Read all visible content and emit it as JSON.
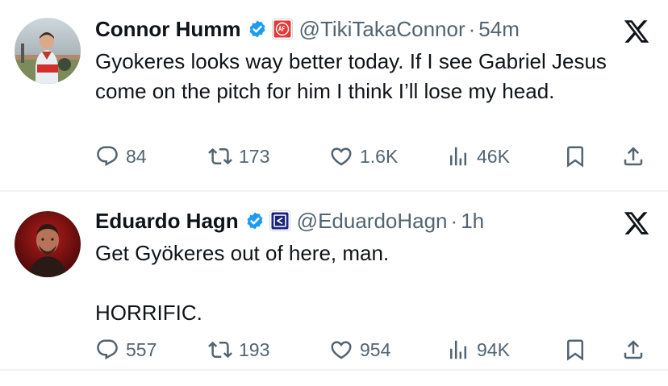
{
  "colors": {
    "text_primary": "#0f1419",
    "text_secondary": "#536471",
    "verified_blue": "#1d9bf0",
    "divider": "#eff3f4"
  },
  "tweets": [
    {
      "name": "Connor Humm",
      "handle": "@TikiTakaConnor",
      "separator": "·",
      "time": "54m",
      "verified_icon": "verified-badge-icon",
      "affiliate_icon": "aftv-badge-icon",
      "text_lines": [
        "Gyokeres looks way better today. If I see Gabriel Jesus come on the pitch for him I think I’ll lose my head."
      ],
      "replies": "84",
      "retweets": "173",
      "likes": "1.6K",
      "views": "46K"
    },
    {
      "name": "Eduardo Hagn",
      "handle": "@EduardoHagn",
      "separator": "·",
      "time": "1h",
      "verified_icon": "verified-badge-icon",
      "affiliate_icon": "blue-affiliate-badge-icon",
      "text_lines": [
        "Get Gyökeres out of here, man.",
        "",
        "HORRIFIC."
      ],
      "replies": "557",
      "retweets": "193",
      "likes": "954",
      "views": "94K"
    }
  ]
}
